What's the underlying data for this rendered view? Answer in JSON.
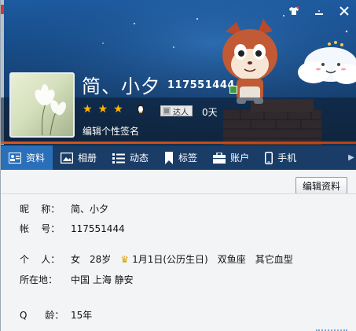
{
  "header": {
    "nickname": "简、小夕",
    "qq_number": "117551444",
    "stars": 3,
    "talent_label": "达人",
    "talent_days": "0天",
    "signature_link": "编辑个性签名"
  },
  "window_controls": {
    "skin_icon": "shirt-icon",
    "minimize_icon": "minimize-icon",
    "close_icon": "close-icon"
  },
  "tabs": [
    {
      "label": "资料",
      "icon": "profile-icon",
      "active": true
    },
    {
      "label": "相册",
      "icon": "album-icon",
      "active": false
    },
    {
      "label": "动态",
      "icon": "feed-icon",
      "active": false
    },
    {
      "label": "标签",
      "icon": "tag-icon",
      "active": false
    },
    {
      "label": "账户",
      "icon": "wallet-icon",
      "active": false
    },
    {
      "label": "手机",
      "icon": "phone-icon",
      "active": false
    }
  ],
  "edit_button": "编辑资料",
  "profile": {
    "nickname_label": "昵    称：",
    "nickname_value": "简、小夕",
    "account_label": "帐    号：",
    "account_value": "117551444",
    "personal_label": "个    人：",
    "gender": "女",
    "age": "28岁",
    "birthday": "1月1日(公历生日)",
    "zodiac": "双鱼座",
    "blood_type": "其它血型",
    "location_label": "所在地：",
    "location_value": "中国 上海 静安",
    "qage_label": "Q      龄：",
    "qage_value": "15年"
  },
  "colors": {
    "accent": "#2a6fba",
    "orange_line": "#d9551f",
    "star": "#ffb400"
  }
}
